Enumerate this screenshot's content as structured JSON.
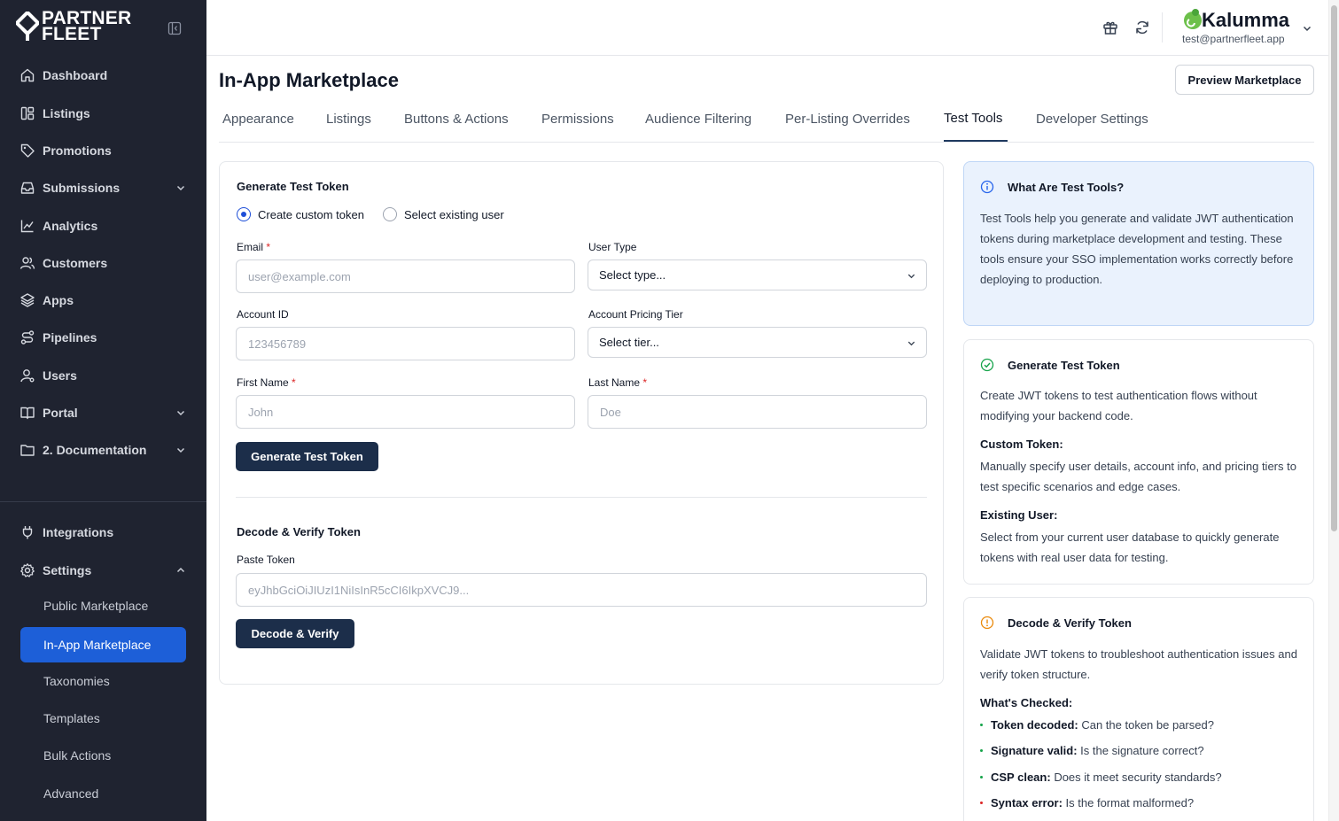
{
  "brand": {
    "line1": "PARTNER",
    "line2": "FLEET"
  },
  "sidebar": {
    "items": [
      {
        "label": "Dashboard"
      },
      {
        "label": "Listings"
      },
      {
        "label": "Promotions"
      },
      {
        "label": "Submissions"
      },
      {
        "label": "Analytics"
      },
      {
        "label": "Customers"
      },
      {
        "label": "Apps"
      },
      {
        "label": "Pipelines"
      },
      {
        "label": "Users"
      },
      {
        "label": "Portal"
      },
      {
        "label": "2. Documentation"
      }
    ],
    "bottom_items": [
      {
        "label": "Integrations"
      },
      {
        "label": "Settings"
      }
    ],
    "settings_sub": [
      {
        "label": "Public Marketplace"
      },
      {
        "label": "In-App Marketplace"
      },
      {
        "label": "Taxonomies"
      },
      {
        "label": "Templates"
      },
      {
        "label": "Bulk Actions"
      },
      {
        "label": "Advanced"
      }
    ]
  },
  "account": {
    "name": "Kalumma",
    "email": "test@partnerfleet.app"
  },
  "page": {
    "title": "In-App Marketplace",
    "preview_button": "Preview Marketplace"
  },
  "tabs": [
    {
      "label": "Appearance"
    },
    {
      "label": "Listings"
    },
    {
      "label": "Buttons & Actions"
    },
    {
      "label": "Permissions"
    },
    {
      "label": "Audience Filtering"
    },
    {
      "label": "Per-Listing Overrides"
    },
    {
      "label": "Test Tools"
    },
    {
      "label": "Developer Settings"
    }
  ],
  "generate": {
    "title": "Generate Test Token",
    "radio_custom": "Create custom token",
    "radio_existing": "Select existing user",
    "email_label": "Email",
    "email_placeholder": "user@example.com",
    "user_type_label": "User Type",
    "user_type_value": "Select type...",
    "account_id_label": "Account ID",
    "account_id_placeholder": "123456789",
    "pricing_tier_label": "Account Pricing Tier",
    "pricing_tier_value": "Select tier...",
    "first_name_label": "First Name",
    "first_name_placeholder": "John",
    "last_name_label": "Last Name",
    "last_name_placeholder": "Doe",
    "required_mark": "*",
    "button": "Generate Test Token"
  },
  "decode": {
    "title": "Decode & Verify Token",
    "paste_label": "Paste Token",
    "paste_placeholder": "eyJhbGciOiJIUzI1NiIsInR5cCI6IkpXVCJ9...",
    "button": "Decode & Verify"
  },
  "info": {
    "title": "What Are Test Tools?",
    "text": "Test Tools help you generate and validate JWT authentication tokens during marketplace development and testing. These tools ensure your SSO implementation works correctly before deploying to production."
  },
  "gen_panel": {
    "title": "Generate Test Token",
    "text": "Create JWT tokens to test authentication flows without modifying your backend code.",
    "custom_title": "Custom Token:",
    "custom_text": "Manually specify user details, account info, and pricing tiers to test specific scenarios and edge cases.",
    "existing_title": "Existing User:",
    "existing_text": "Select from your current user database to quickly generate tokens with real user data for testing."
  },
  "decode_panel": {
    "title": "Decode & Verify Token",
    "text": "Validate JWT tokens to troubleshoot authentication issues and verify token structure.",
    "checked_title": "What's Checked:",
    "checks": [
      {
        "term": "Token decoded:",
        "desc": "Can the token be parsed?",
        "color": "#16a34a"
      },
      {
        "term": "Signature valid:",
        "desc": "Is the signature correct?",
        "color": "#16a34a"
      },
      {
        "term": "CSP clean:",
        "desc": "Does it meet security standards?",
        "color": "#16a34a"
      },
      {
        "term": "Syntax error:",
        "desc": "Is the format malformed?",
        "color": "#dc2626"
      }
    ]
  },
  "colors": {
    "sidebar_bg": "#1f2330",
    "active": "#1d5fd8",
    "primary_button": "#1c2e4a",
    "info_bg": "#eaf2fd"
  }
}
